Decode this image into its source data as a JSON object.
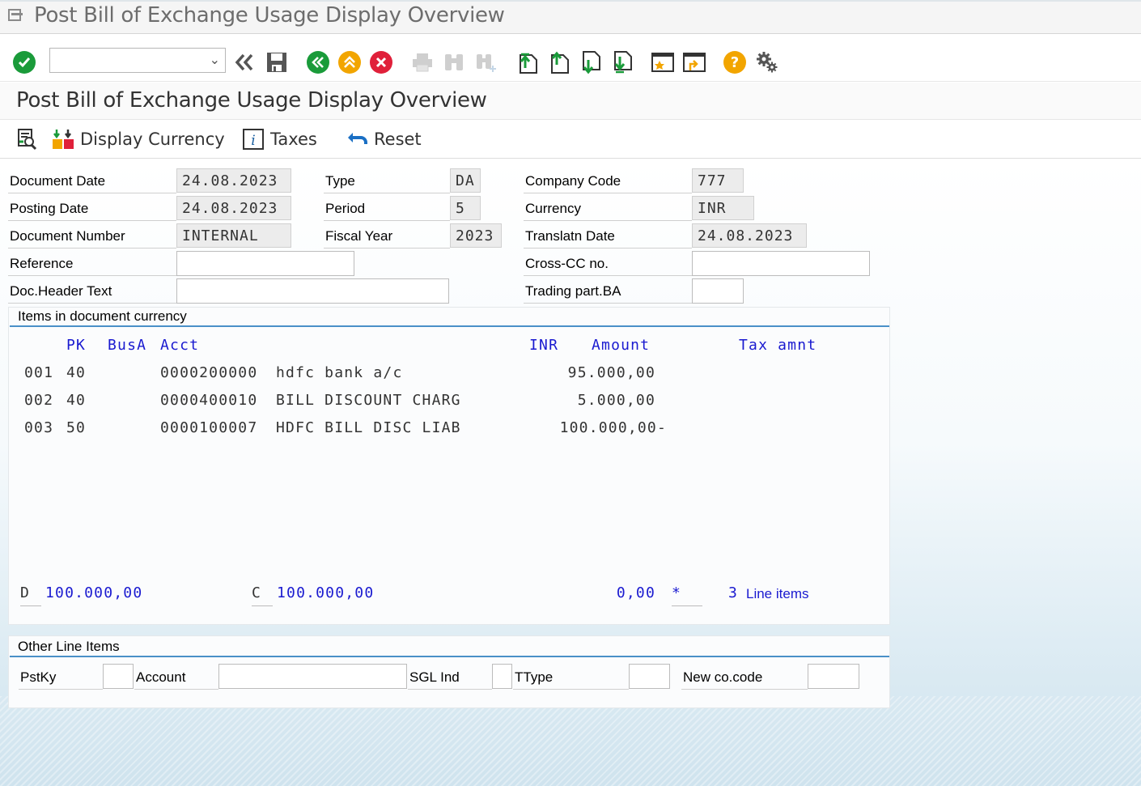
{
  "window": {
    "title": "Post Bill of Exchange Usage Display Overview"
  },
  "toolbar": {
    "command_field_value": "",
    "icons": [
      "check-icon",
      "command-dropdown-icon",
      "back-double-icon",
      "save-icon",
      "back-icon",
      "exit-icon",
      "cancel-icon",
      "print-icon",
      "find-icon",
      "find-next-icon",
      "first-page-icon",
      "previous-page-icon",
      "next-page-icon",
      "last-page-icon",
      "create-session-icon",
      "shortcut-icon",
      "help-icon",
      "settings-icon"
    ]
  },
  "page": {
    "title": "Post Bill of Exchange Usage Display Overview"
  },
  "app_toolbar": {
    "display_currency_label": "Display Currency",
    "taxes_label": "Taxes",
    "reset_label": "Reset"
  },
  "header": {
    "document_date": {
      "label": "Document Date",
      "value": "24.08.2023"
    },
    "posting_date": {
      "label": "Posting Date",
      "value": "24.08.2023"
    },
    "document_number": {
      "label": "Document Number",
      "value": "INTERNAL"
    },
    "reference": {
      "label": "Reference",
      "value": ""
    },
    "doc_header_text": {
      "label": "Doc.Header Text",
      "value": ""
    },
    "type": {
      "label": "Type",
      "value": "DA"
    },
    "period": {
      "label": "Period",
      "value": "5"
    },
    "fiscal_year": {
      "label": "Fiscal Year",
      "value": "2023"
    },
    "company_code": {
      "label": "Company Code",
      "value": "777"
    },
    "currency": {
      "label": "Currency",
      "value": "INR"
    },
    "translatn_date": {
      "label": "Translatn Date",
      "value": "24.08.2023"
    },
    "cross_cc": {
      "label": "Cross-CC no.",
      "value": ""
    },
    "trading_part": {
      "label": "Trading part.BA",
      "value": ""
    }
  },
  "items": {
    "title": "Items in document currency",
    "columns": {
      "pk": "PK",
      "busa": "BusA",
      "acct": "Acct",
      "currency": "INR",
      "amount": "Amount",
      "tax": "Tax amnt"
    },
    "rows": [
      {
        "no": "001",
        "pk": "40",
        "acct": "0000200000",
        "name": "hdfc bank a/c",
        "amount": "95.000,00"
      },
      {
        "no": "002",
        "pk": "40",
        "acct": "0000400010",
        "name": "BILL DISCOUNT CHARG",
        "amount": "5.000,00"
      },
      {
        "no": "003",
        "pk": "50",
        "acct": "0000100007",
        "name": "HDFC BILL DISC LIAB",
        "amount": "100.000,00-"
      }
    ],
    "totals": {
      "debit_label": "D",
      "debit": "100.000,00",
      "credit_label": "C",
      "credit": "100.000,00",
      "balance": "0,00",
      "balance_flag": "*",
      "line_count": "3",
      "line_items_label": "Line items"
    }
  },
  "other_items": {
    "title": "Other Line Items",
    "pstky": {
      "label": "PstKy",
      "value": ""
    },
    "account": {
      "label": "Account",
      "value": ""
    },
    "sgl_ind": {
      "label": "SGL Ind",
      "value": ""
    },
    "ttype": {
      "label": "TType",
      "value": ""
    },
    "new_cocode": {
      "label": "New co.code",
      "value": ""
    }
  },
  "colors": {
    "green": "#1a9b3a",
    "orange": "#f2a500",
    "red": "#e0203a",
    "blue_text": "#1a1ad0",
    "accent_line": "#4a90c8"
  }
}
